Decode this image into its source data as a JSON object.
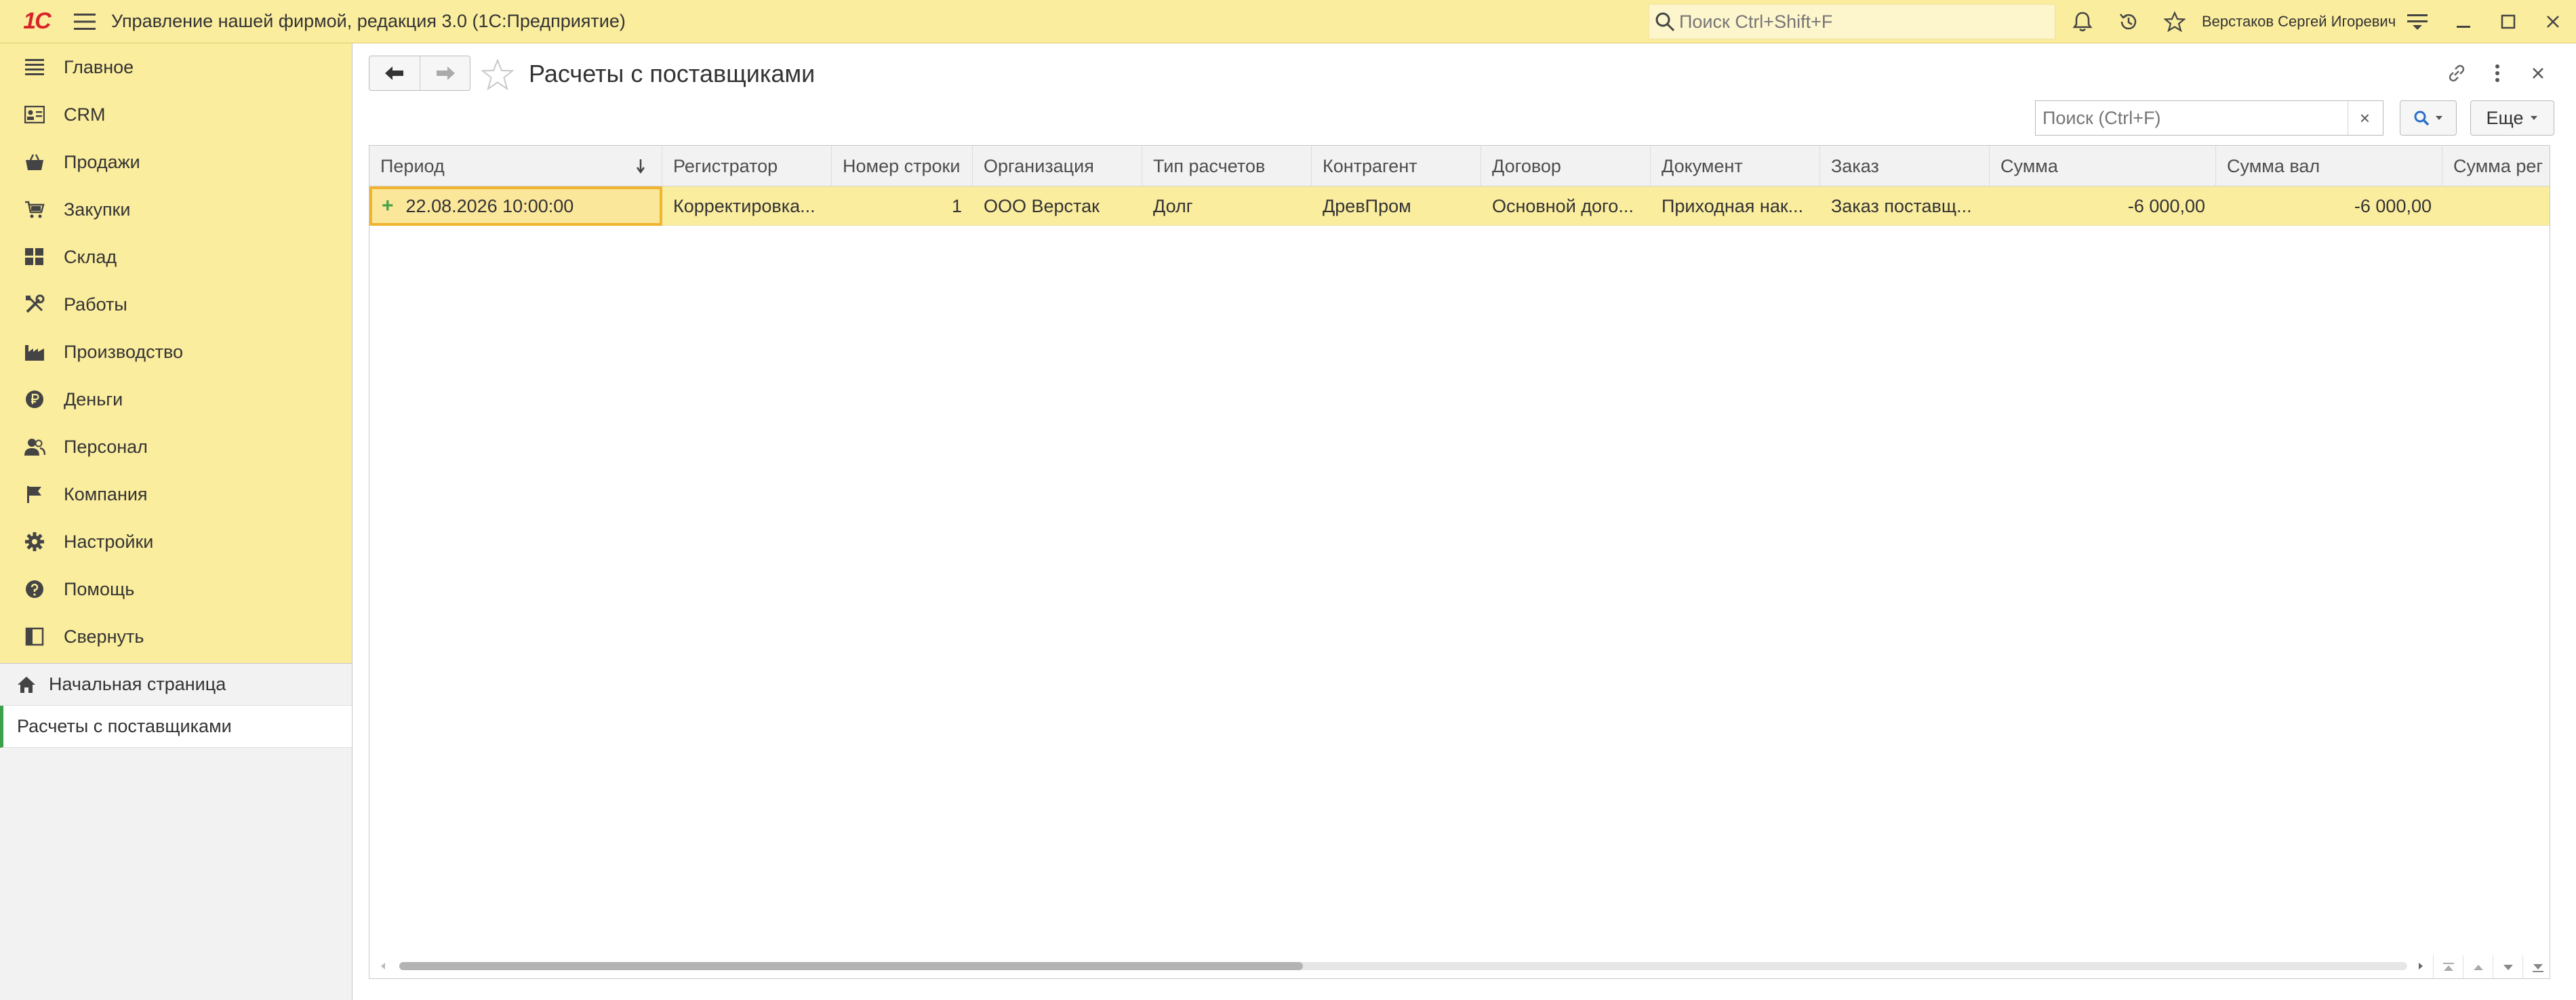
{
  "app": {
    "logo_text": "1С",
    "title": "Управление нашей фирмой, редакция 3.0  (1С:Предприятие)",
    "search_placeholder": "Поиск Ctrl+Shift+F",
    "user_name": "Верстаков Сергей Игоревич",
    "brand_color": "#d8232a",
    "bar_color": "#fbed9e"
  },
  "sidebar": {
    "sections": [
      {
        "label": "Главное",
        "icon": "menu-lines-icon"
      },
      {
        "label": "CRM",
        "icon": "contact-card-icon"
      },
      {
        "label": "Продажи",
        "icon": "shopping-basket-icon"
      },
      {
        "label": "Закупки",
        "icon": "cart-icon"
      },
      {
        "label": "Склад",
        "icon": "warehouse-grid-icon"
      },
      {
        "label": "Работы",
        "icon": "tools-icon"
      },
      {
        "label": "Производство",
        "icon": "factory-icon"
      },
      {
        "label": "Деньги",
        "icon": "ruble-coin-icon"
      },
      {
        "label": "Персонал",
        "icon": "people-icon"
      },
      {
        "label": "Компания",
        "icon": "flag-icon"
      },
      {
        "label": "Настройки",
        "icon": "gear-icon"
      },
      {
        "label": "Помощь",
        "icon": "help-icon"
      },
      {
        "label": "Свернуть",
        "icon": "collapse-panel-icon"
      }
    ],
    "home_label": "Начальная страница",
    "open_form_label": "Расчеты с поставщиками"
  },
  "form": {
    "title": "Расчеты с поставщиками",
    "search_placeholder": "Поиск (Ctrl+F)",
    "clear_label": "×",
    "more_label": "Еще"
  },
  "table": {
    "columns": [
      "Период",
      "Регистратор",
      "Номер строки",
      "Организация",
      "Тип расчетов",
      "Контрагент",
      "Договор",
      "Документ",
      "Заказ",
      "Сумма",
      "Сумма вал",
      "Сумма рег"
    ],
    "rows": [
      {
        "period": "22.08.2026 10:00:00",
        "registrar": "Корректировка...",
        "line_number": "1",
        "organization": "ООО Верстак",
        "settlement_type": "Долг",
        "counterparty": "ДревПром",
        "contract": "Основной дого...",
        "document": "Приходная нак...",
        "order": "Заказ поставщ...",
        "amount": "-6 000,00",
        "amount_currency": "-6 000,00",
        "amount_reg": ""
      }
    ],
    "scroll_fraction": 0.45
  }
}
